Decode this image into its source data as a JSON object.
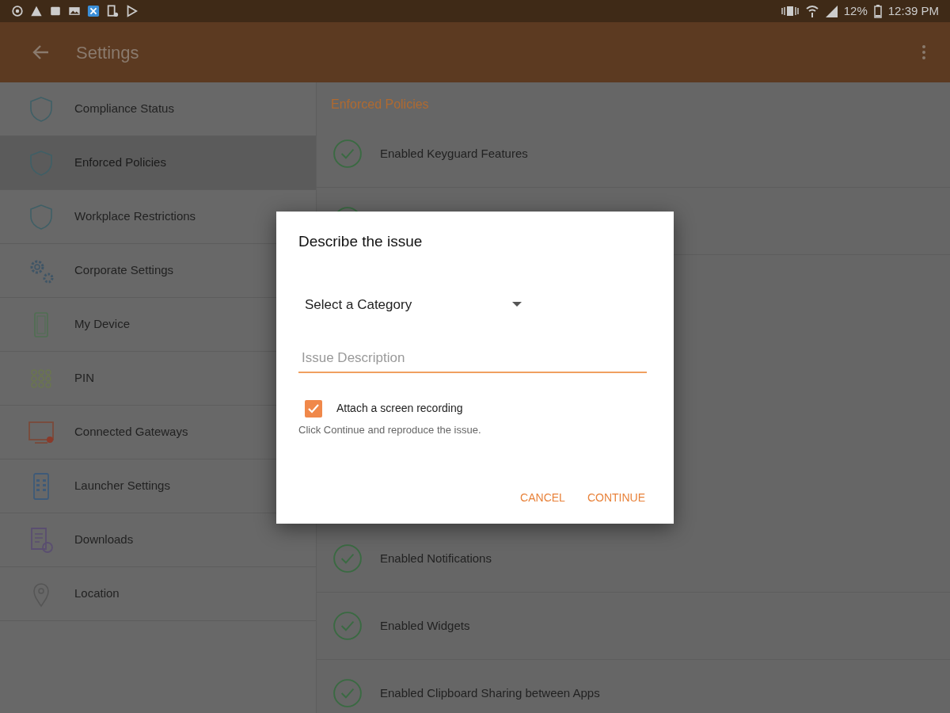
{
  "status_bar": {
    "battery": "12%",
    "time": "12:39 PM"
  },
  "app_bar": {
    "title": "Settings"
  },
  "sidebar": {
    "items": [
      {
        "label": "Compliance Status",
        "kind": "shield",
        "selected": false
      },
      {
        "label": "Enforced Policies",
        "kind": "shield",
        "selected": true
      },
      {
        "label": "Workplace Restrictions",
        "kind": "shield",
        "selected": false
      },
      {
        "label": "Corporate Settings",
        "kind": "gears",
        "selected": false
      },
      {
        "label": "My Device",
        "kind": "phone",
        "selected": false
      },
      {
        "label": "PIN",
        "kind": "keypad",
        "selected": false
      },
      {
        "label": "Connected Gateways",
        "kind": "monitor",
        "selected": false
      },
      {
        "label": "Launcher Settings",
        "kind": "launcher",
        "selected": false
      },
      {
        "label": "Downloads",
        "kind": "document",
        "selected": false
      },
      {
        "label": "Location",
        "kind": "pin",
        "selected": false
      }
    ]
  },
  "policies": {
    "heading": "Enforced Policies",
    "items_above": [
      {
        "label": "Enabled Keyguard Features"
      }
    ],
    "items_below": [
      {
        "label": "Enabled Notifications"
      },
      {
        "label": "Enabled Widgets"
      },
      {
        "label": "Enabled Clipboard Sharing between Apps"
      }
    ]
  },
  "dialog": {
    "title": "Describe the issue",
    "category": "Select a Category",
    "description": {
      "placeholder": "Issue Description"
    },
    "attach": {
      "label": "Attach a screen recording",
      "checked": true
    },
    "hint": "Click Continue and reproduce the issue.",
    "buttons": [
      "CANCEL",
      "CONTINUE"
    ]
  }
}
